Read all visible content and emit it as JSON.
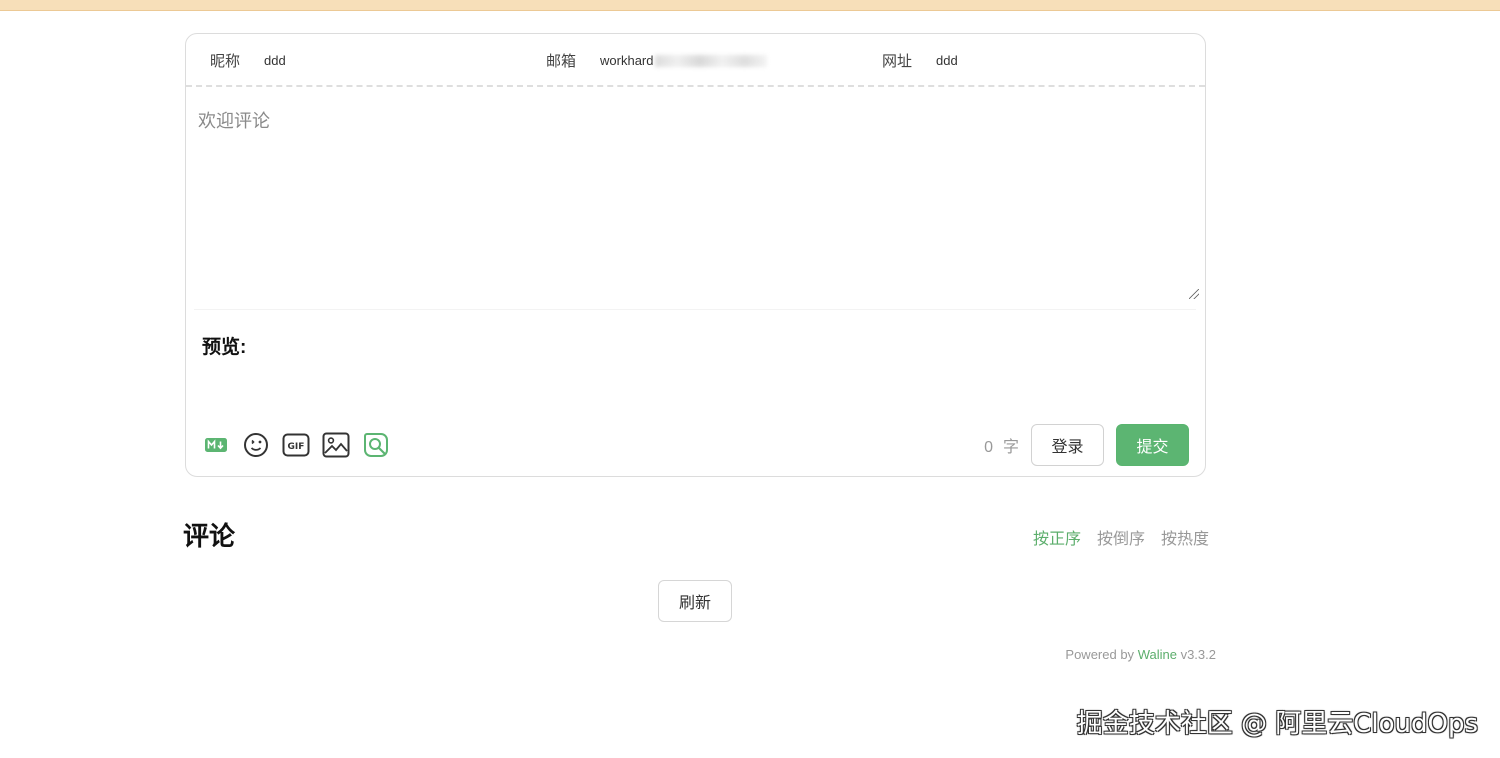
{
  "colors": {
    "accent": "#5cb572",
    "top_strip": "#f7dfb9"
  },
  "form": {
    "nick_label": "昵称",
    "nick_value": "ddd",
    "mail_label": "邮箱",
    "mail_value": "workhard",
    "link_label": "网址",
    "link_value": "ddd",
    "editor_placeholder": "欢迎评论",
    "preview_label": "预览:"
  },
  "toolbar": {
    "icons": [
      "markdown-icon",
      "emoji-icon",
      "gif-icon",
      "image-icon",
      "preview-icon"
    ],
    "word_count_value": "0",
    "word_count_unit": "字",
    "login_label": "登录",
    "submit_label": "提交"
  },
  "comments": {
    "title": "评论",
    "sort": [
      "按正序",
      "按倒序",
      "按热度"
    ],
    "active_sort": "按正序",
    "refresh_label": "刷新"
  },
  "footer": {
    "powered_prefix": "Powered by",
    "brand": "Waline",
    "version": "v3.3.2"
  },
  "watermark": "掘金技术社区 @ 阿里云CloudOps"
}
